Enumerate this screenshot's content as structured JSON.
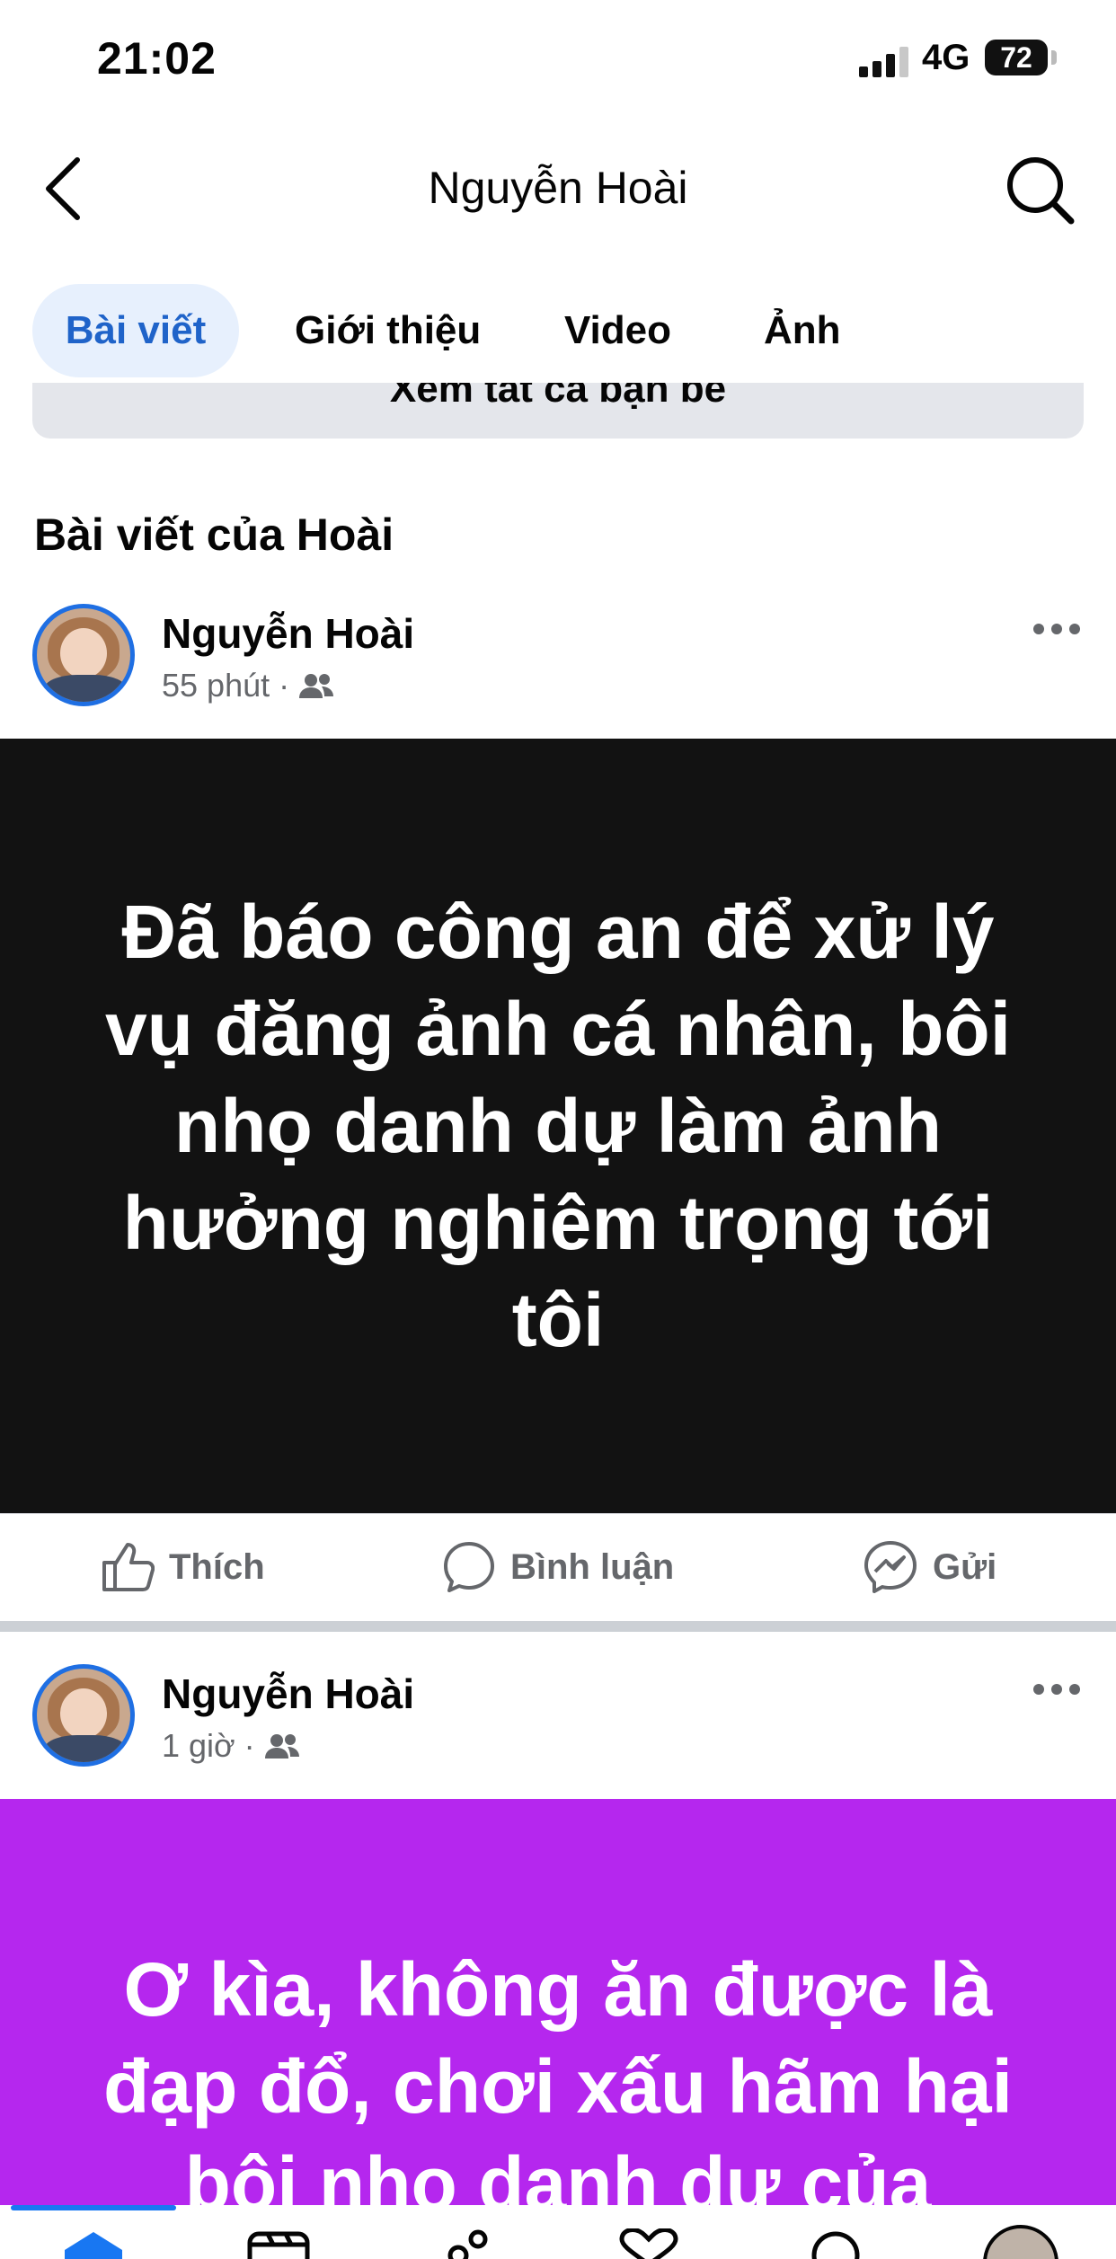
{
  "status": {
    "time": "21:02",
    "network": "4G",
    "battery": "72"
  },
  "header": {
    "title": "Nguyễn Hoài"
  },
  "tabs": [
    "Bài viết",
    "Giới thiệu",
    "Video",
    "Ảnh"
  ],
  "friends_button": "Xem tất cả bạn bè",
  "section_title": "Bài viết của Hoài",
  "posts": [
    {
      "author": "Nguyễn Hoài",
      "time": "55 phút",
      "text": "Đã báo công an để xử lý vụ đăng ảnh cá nhân, bôi nhọ danh dự làm ảnh hưởng nghiêm trọng tới tôi",
      "background": "#121212"
    },
    {
      "author": "Nguyễn Hoài",
      "time": "1 giờ",
      "text": "Ơ kìa, không ăn được là đạp đổ, chơi xấu hãm hại bôi nhọ danh dự của",
      "background": "#b527ee"
    }
  ],
  "actions": {
    "like": "Thích",
    "comment": "Bình luận",
    "share": "Gửi"
  },
  "colors": {
    "accent": "#1f63c9",
    "tab_active_bg": "#e7f0fd",
    "nav_indicator": "#1877f2"
  },
  "nav_icons": [
    "home-icon",
    "video-icon",
    "friends-icon",
    "dating-icon",
    "search-icon",
    "profile-avatar"
  ]
}
